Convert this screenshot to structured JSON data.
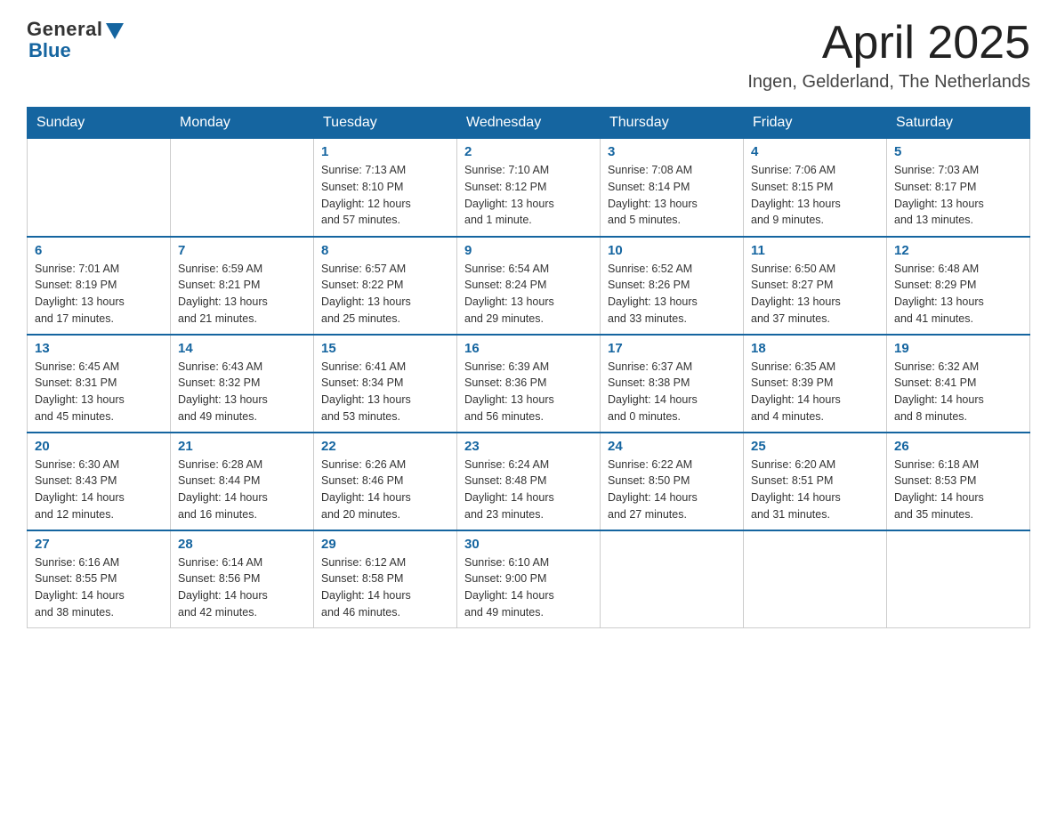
{
  "header": {
    "logo_general": "General",
    "logo_blue": "Blue",
    "month_title": "April 2025",
    "location": "Ingen, Gelderland, The Netherlands"
  },
  "calendar": {
    "days_of_week": [
      "Sunday",
      "Monday",
      "Tuesday",
      "Wednesday",
      "Thursday",
      "Friday",
      "Saturday"
    ],
    "weeks": [
      [
        {
          "day": "",
          "info": ""
        },
        {
          "day": "",
          "info": ""
        },
        {
          "day": "1",
          "info": "Sunrise: 7:13 AM\nSunset: 8:10 PM\nDaylight: 12 hours\nand 57 minutes."
        },
        {
          "day": "2",
          "info": "Sunrise: 7:10 AM\nSunset: 8:12 PM\nDaylight: 13 hours\nand 1 minute."
        },
        {
          "day": "3",
          "info": "Sunrise: 7:08 AM\nSunset: 8:14 PM\nDaylight: 13 hours\nand 5 minutes."
        },
        {
          "day": "4",
          "info": "Sunrise: 7:06 AM\nSunset: 8:15 PM\nDaylight: 13 hours\nand 9 minutes."
        },
        {
          "day": "5",
          "info": "Sunrise: 7:03 AM\nSunset: 8:17 PM\nDaylight: 13 hours\nand 13 minutes."
        }
      ],
      [
        {
          "day": "6",
          "info": "Sunrise: 7:01 AM\nSunset: 8:19 PM\nDaylight: 13 hours\nand 17 minutes."
        },
        {
          "day": "7",
          "info": "Sunrise: 6:59 AM\nSunset: 8:21 PM\nDaylight: 13 hours\nand 21 minutes."
        },
        {
          "day": "8",
          "info": "Sunrise: 6:57 AM\nSunset: 8:22 PM\nDaylight: 13 hours\nand 25 minutes."
        },
        {
          "day": "9",
          "info": "Sunrise: 6:54 AM\nSunset: 8:24 PM\nDaylight: 13 hours\nand 29 minutes."
        },
        {
          "day": "10",
          "info": "Sunrise: 6:52 AM\nSunset: 8:26 PM\nDaylight: 13 hours\nand 33 minutes."
        },
        {
          "day": "11",
          "info": "Sunrise: 6:50 AM\nSunset: 8:27 PM\nDaylight: 13 hours\nand 37 minutes."
        },
        {
          "day": "12",
          "info": "Sunrise: 6:48 AM\nSunset: 8:29 PM\nDaylight: 13 hours\nand 41 minutes."
        }
      ],
      [
        {
          "day": "13",
          "info": "Sunrise: 6:45 AM\nSunset: 8:31 PM\nDaylight: 13 hours\nand 45 minutes."
        },
        {
          "day": "14",
          "info": "Sunrise: 6:43 AM\nSunset: 8:32 PM\nDaylight: 13 hours\nand 49 minutes."
        },
        {
          "day": "15",
          "info": "Sunrise: 6:41 AM\nSunset: 8:34 PM\nDaylight: 13 hours\nand 53 minutes."
        },
        {
          "day": "16",
          "info": "Sunrise: 6:39 AM\nSunset: 8:36 PM\nDaylight: 13 hours\nand 56 minutes."
        },
        {
          "day": "17",
          "info": "Sunrise: 6:37 AM\nSunset: 8:38 PM\nDaylight: 14 hours\nand 0 minutes."
        },
        {
          "day": "18",
          "info": "Sunrise: 6:35 AM\nSunset: 8:39 PM\nDaylight: 14 hours\nand 4 minutes."
        },
        {
          "day": "19",
          "info": "Sunrise: 6:32 AM\nSunset: 8:41 PM\nDaylight: 14 hours\nand 8 minutes."
        }
      ],
      [
        {
          "day": "20",
          "info": "Sunrise: 6:30 AM\nSunset: 8:43 PM\nDaylight: 14 hours\nand 12 minutes."
        },
        {
          "day": "21",
          "info": "Sunrise: 6:28 AM\nSunset: 8:44 PM\nDaylight: 14 hours\nand 16 minutes."
        },
        {
          "day": "22",
          "info": "Sunrise: 6:26 AM\nSunset: 8:46 PM\nDaylight: 14 hours\nand 20 minutes."
        },
        {
          "day": "23",
          "info": "Sunrise: 6:24 AM\nSunset: 8:48 PM\nDaylight: 14 hours\nand 23 minutes."
        },
        {
          "day": "24",
          "info": "Sunrise: 6:22 AM\nSunset: 8:50 PM\nDaylight: 14 hours\nand 27 minutes."
        },
        {
          "day": "25",
          "info": "Sunrise: 6:20 AM\nSunset: 8:51 PM\nDaylight: 14 hours\nand 31 minutes."
        },
        {
          "day": "26",
          "info": "Sunrise: 6:18 AM\nSunset: 8:53 PM\nDaylight: 14 hours\nand 35 minutes."
        }
      ],
      [
        {
          "day": "27",
          "info": "Sunrise: 6:16 AM\nSunset: 8:55 PM\nDaylight: 14 hours\nand 38 minutes."
        },
        {
          "day": "28",
          "info": "Sunrise: 6:14 AM\nSunset: 8:56 PM\nDaylight: 14 hours\nand 42 minutes."
        },
        {
          "day": "29",
          "info": "Sunrise: 6:12 AM\nSunset: 8:58 PM\nDaylight: 14 hours\nand 46 minutes."
        },
        {
          "day": "30",
          "info": "Sunrise: 6:10 AM\nSunset: 9:00 PM\nDaylight: 14 hours\nand 49 minutes."
        },
        {
          "day": "",
          "info": ""
        },
        {
          "day": "",
          "info": ""
        },
        {
          "day": "",
          "info": ""
        }
      ]
    ]
  }
}
